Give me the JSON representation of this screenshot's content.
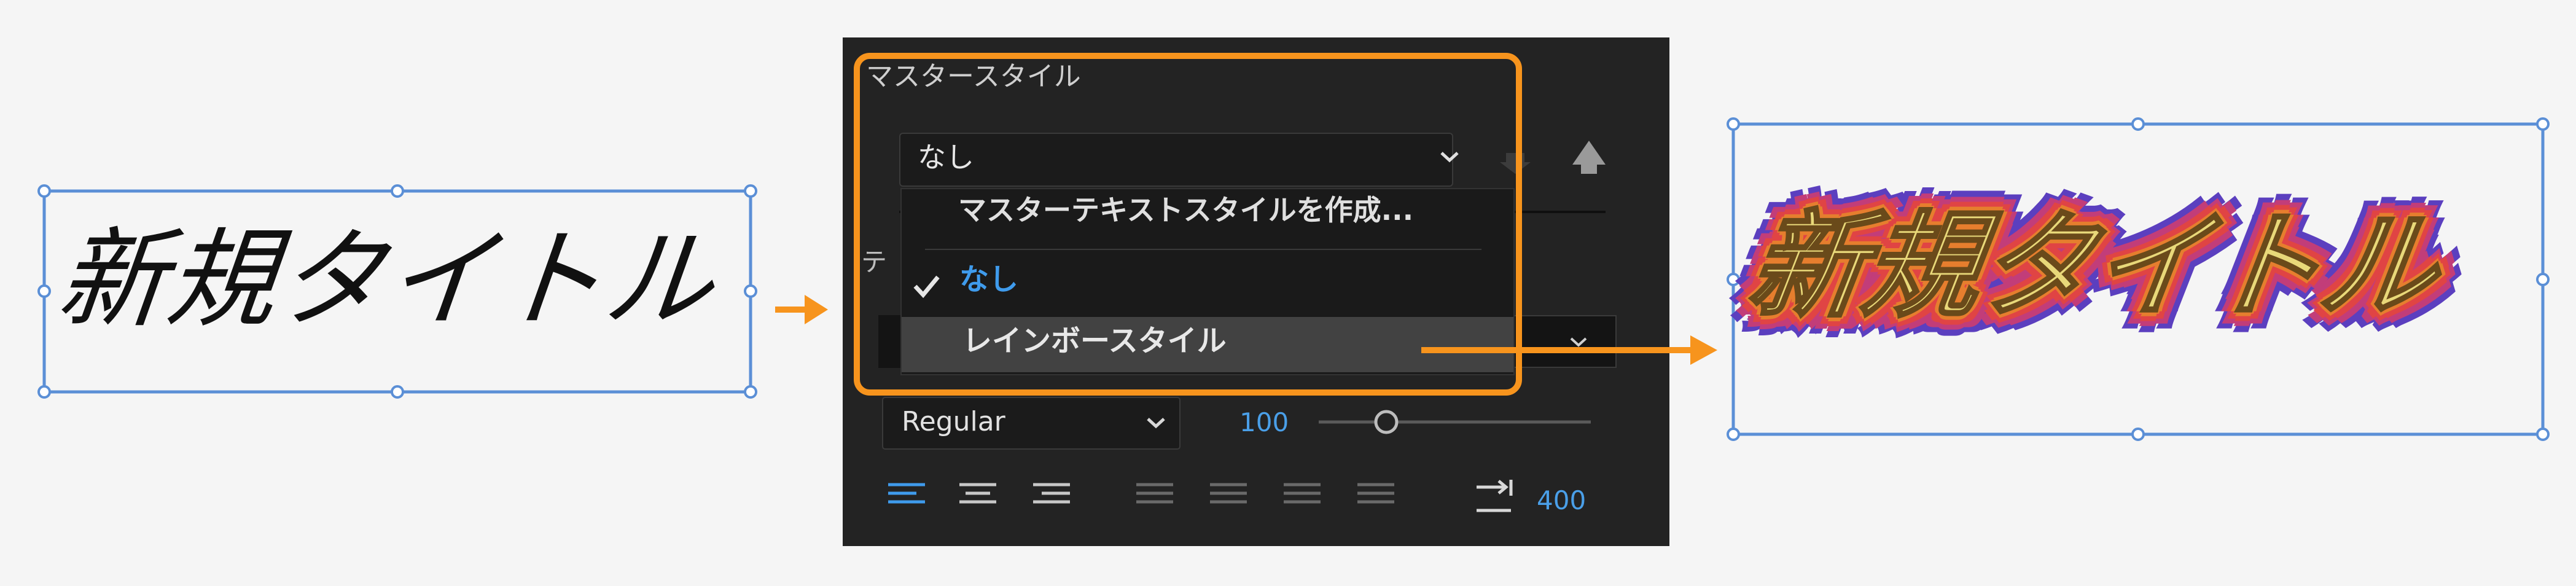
{
  "left_title": {
    "text": "新規タイトル"
  },
  "panel": {
    "master_style_label": "マスタースタイル",
    "style_select_value": "なし",
    "menu": {
      "create_item": "マスターテキストスタイルを作成...",
      "none_item": "なし",
      "rainbow_item": "レインボースタイル"
    },
    "section_stub": "テ",
    "font_style_value": "Regular",
    "font_size_value": "100",
    "tracking_value": "400"
  },
  "right_title": {
    "text": "新規タイトル"
  },
  "colors": {
    "accent_orange": "#f7941d",
    "selection_blue": "#5b8fd6",
    "panel_bg": "#232323",
    "value_blue": "#4a9fe8"
  },
  "icons": [
    "chevron-down-icon",
    "arrow-down-icon",
    "arrow-up-icon",
    "checkmark-icon",
    "align-left-icon",
    "align-center-icon",
    "align-right-icon",
    "justify-icon",
    "tab-indent-icon",
    "arrow-right-icon"
  ]
}
